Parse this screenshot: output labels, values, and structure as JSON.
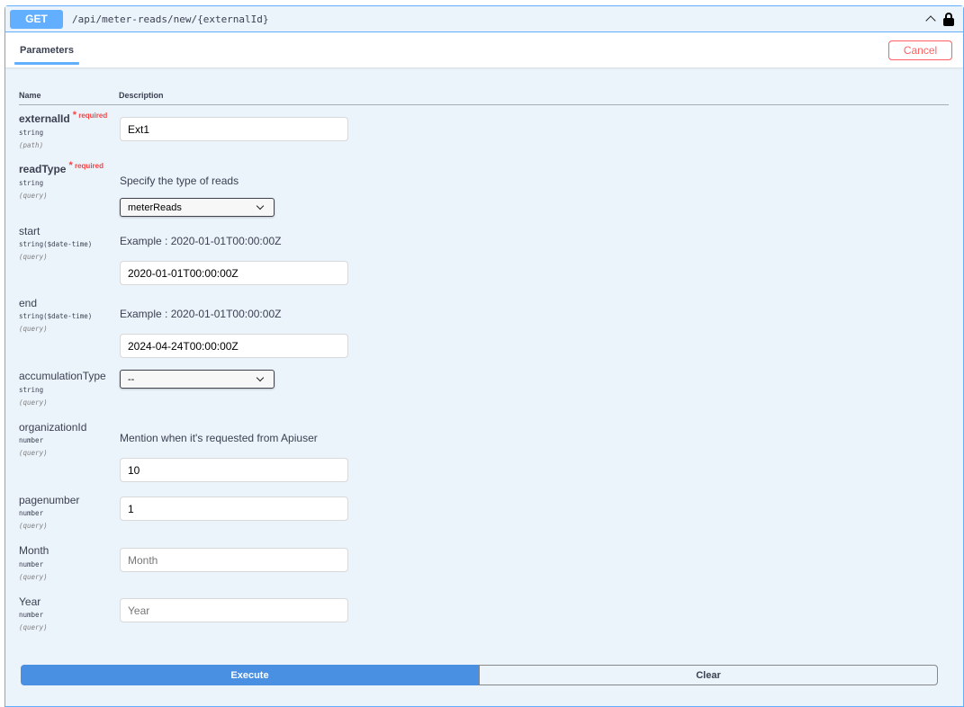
{
  "endpoint": {
    "method": "GET",
    "path": "/api/meter-reads/new/{externalId}",
    "icons": [
      "chevron-up-icon",
      "lock-icon"
    ]
  },
  "tabs": {
    "parameters_label": "Parameters",
    "cancel_label": "Cancel"
  },
  "table": {
    "col_name": "Name",
    "col_description": "Description"
  },
  "required_label": "required",
  "required_star": "*",
  "params": [
    {
      "name": "externalId",
      "type": "string",
      "in": "(path)",
      "required": true,
      "value": "Ext1"
    },
    {
      "name": "readType",
      "type": "string",
      "in": "(query)",
      "required": true,
      "description": "Specify the type of reads",
      "selected": "meterReads"
    },
    {
      "name": "start",
      "type": "string($date-time)",
      "in": "(query)",
      "description": "Example : 2020-01-01T00:00:00Z",
      "value": "2020-01-01T00:00:00Z"
    },
    {
      "name": "end",
      "type": "string($date-time)",
      "in": "(query)",
      "description": "Example : 2020-01-01T00:00:00Z",
      "value": "2024-04-24T00:00:00Z"
    },
    {
      "name": "accumulationType",
      "type": "string",
      "in": "(query)",
      "selected": "--"
    },
    {
      "name": "organizationId",
      "type": "number",
      "in": "(query)",
      "description": "Mention when it's requested from Apiuser",
      "value": "10"
    },
    {
      "name": "pagenumber",
      "type": "number",
      "in": "(query)",
      "value": "1"
    },
    {
      "name": "Month",
      "type": "number",
      "in": "(query)",
      "placeholder": "Month",
      "value": ""
    },
    {
      "name": "Year",
      "type": "number",
      "in": "(query)",
      "placeholder": "Year",
      "value": ""
    }
  ],
  "actions": {
    "execute_label": "Execute",
    "clear_label": "Clear"
  },
  "colors": {
    "accent": "#61affe",
    "execute": "#4990e2",
    "cancel": "#ff6060",
    "background": "#ebf3fb"
  }
}
